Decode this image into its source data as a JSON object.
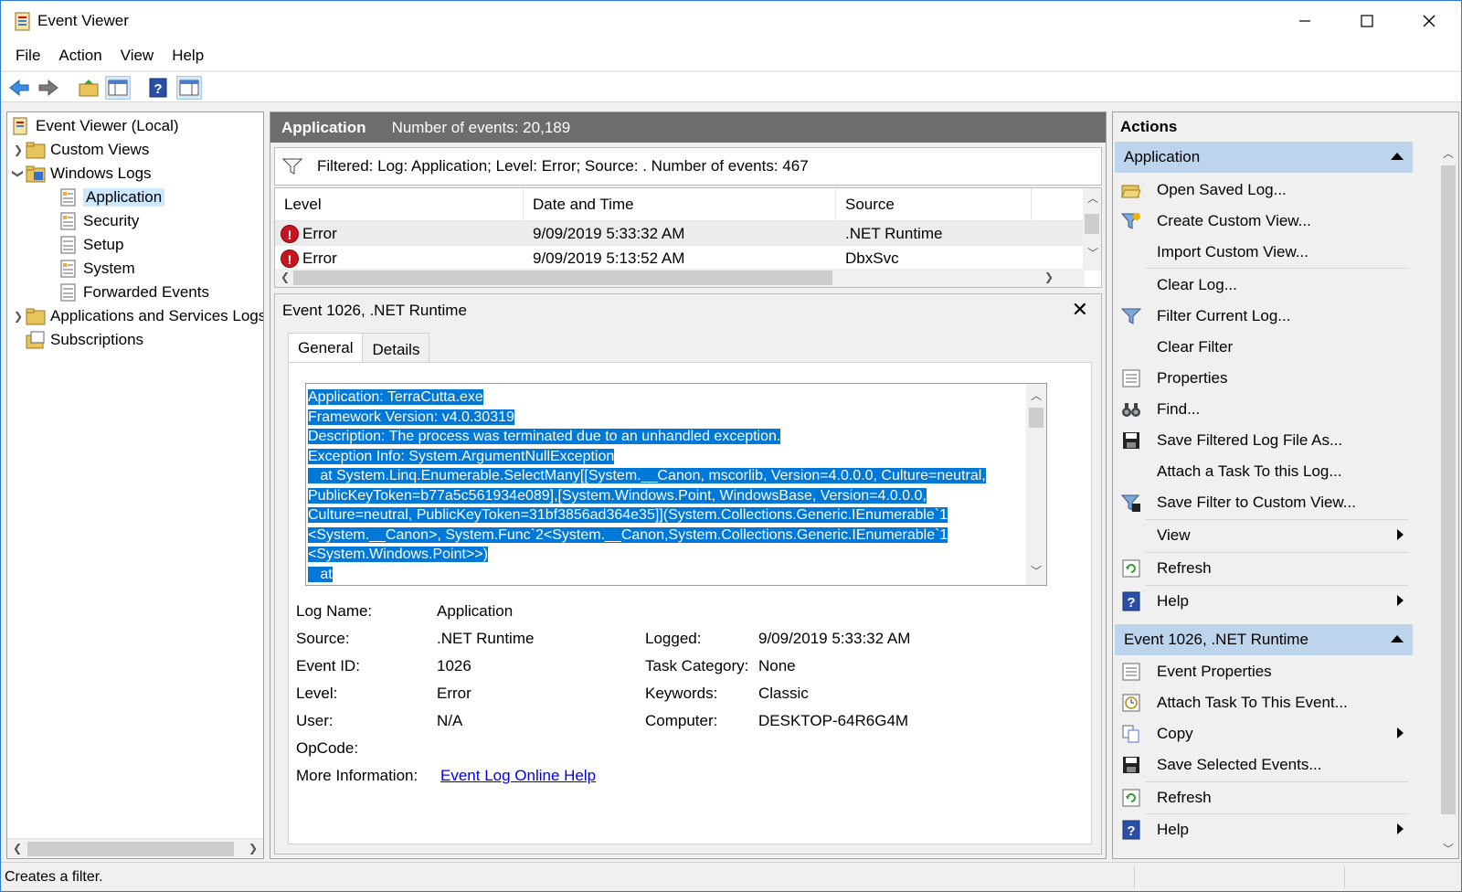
{
  "window": {
    "title": "Event Viewer",
    "minimize": "—",
    "maximize": "☐",
    "close": "✕"
  },
  "menu": [
    "File",
    "Action",
    "View",
    "Help"
  ],
  "tree": {
    "root": "Event Viewer (Local)",
    "custom_views": "Custom Views",
    "windows_logs": "Windows Logs",
    "logs": [
      "Application",
      "Security",
      "Setup",
      "System",
      "Forwarded Events"
    ],
    "app_services": "Applications and Services Logs",
    "subscriptions": "Subscriptions"
  },
  "center": {
    "log_name": "Application",
    "event_count": "Number of events: 20,189",
    "filter_text": "Filtered: Log: Application; Level: Error; Source: . Number of events: 467",
    "columns": [
      "Level",
      "Date and Time",
      "Source"
    ],
    "rows": [
      {
        "level": "Error",
        "datetime": "9/09/2019 5:33:32 AM",
        "source": ".NET Runtime"
      },
      {
        "level": "Error",
        "datetime": "9/09/2019 5:13:52 AM",
        "source": "DbxSvc"
      }
    ]
  },
  "detail": {
    "title": "Event 1026, .NET Runtime",
    "tabs": [
      "General",
      "Details"
    ],
    "description_lines": [
      "Application: TerraCutta.exe",
      "Framework Version: v4.0.30319",
      "Description: The process was terminated due to an unhandled exception.",
      "Exception Info: System.ArgumentNullException",
      "   at System.Linq.Enumerable.SelectMany[[System.__Canon, mscorlib, Version=4.0.0.0, Culture=neutral,",
      "PublicKeyToken=b77a5c561934e089],[System.Windows.Point, WindowsBase, Version=4.0.0.0,",
      "Culture=neutral, PublicKeyToken=31bf3856ad364e35]](System.Collections.Generic.IEnumerable`1",
      "<System.__Canon>, System.Func`2<System.__Canon,System.Collections.Generic.IEnumerable`1",
      "<System.Windows.Point>>)",
      "   at"
    ],
    "labels": {
      "log_name": "Log Name:",
      "source": "Source:",
      "event_id": "Event ID:",
      "level": "Level:",
      "user": "User:",
      "opcode": "OpCode:",
      "more_info": "More Information:",
      "logged": "Logged:",
      "task_category": "Task Category:",
      "keywords": "Keywords:",
      "computer": "Computer:"
    },
    "values": {
      "log_name": "Application",
      "source": ".NET Runtime",
      "event_id": "1026",
      "level": "Error",
      "user": "N/A",
      "opcode": "",
      "more_info": "Event Log Online Help",
      "logged": "9/09/2019 5:33:32 AM",
      "task_category": "None",
      "keywords": "Classic",
      "computer": "DESKTOP-64R6G4M"
    }
  },
  "actions": {
    "title": "Actions",
    "group1": "Application",
    "group1_items": [
      "Open Saved Log...",
      "Create Custom View...",
      "Import Custom View...",
      "Clear Log...",
      "Filter Current Log...",
      "Clear Filter",
      "Properties",
      "Find...",
      "Save Filtered Log File As...",
      "Attach a Task To this Log...",
      "Save Filter to Custom View...",
      "View",
      "Refresh",
      "Help"
    ],
    "group2": "Event 1026, .NET Runtime",
    "group2_items": [
      "Event Properties",
      "Attach Task To This Event...",
      "Copy",
      "Save Selected Events...",
      "Refresh",
      "Help"
    ]
  },
  "status": {
    "text": "Creates a filter."
  },
  "colors": {
    "selection": "#0078d7",
    "group_header": "#bcd4ec",
    "error": "#c8141e",
    "panel_header": "#6d6d6d"
  }
}
